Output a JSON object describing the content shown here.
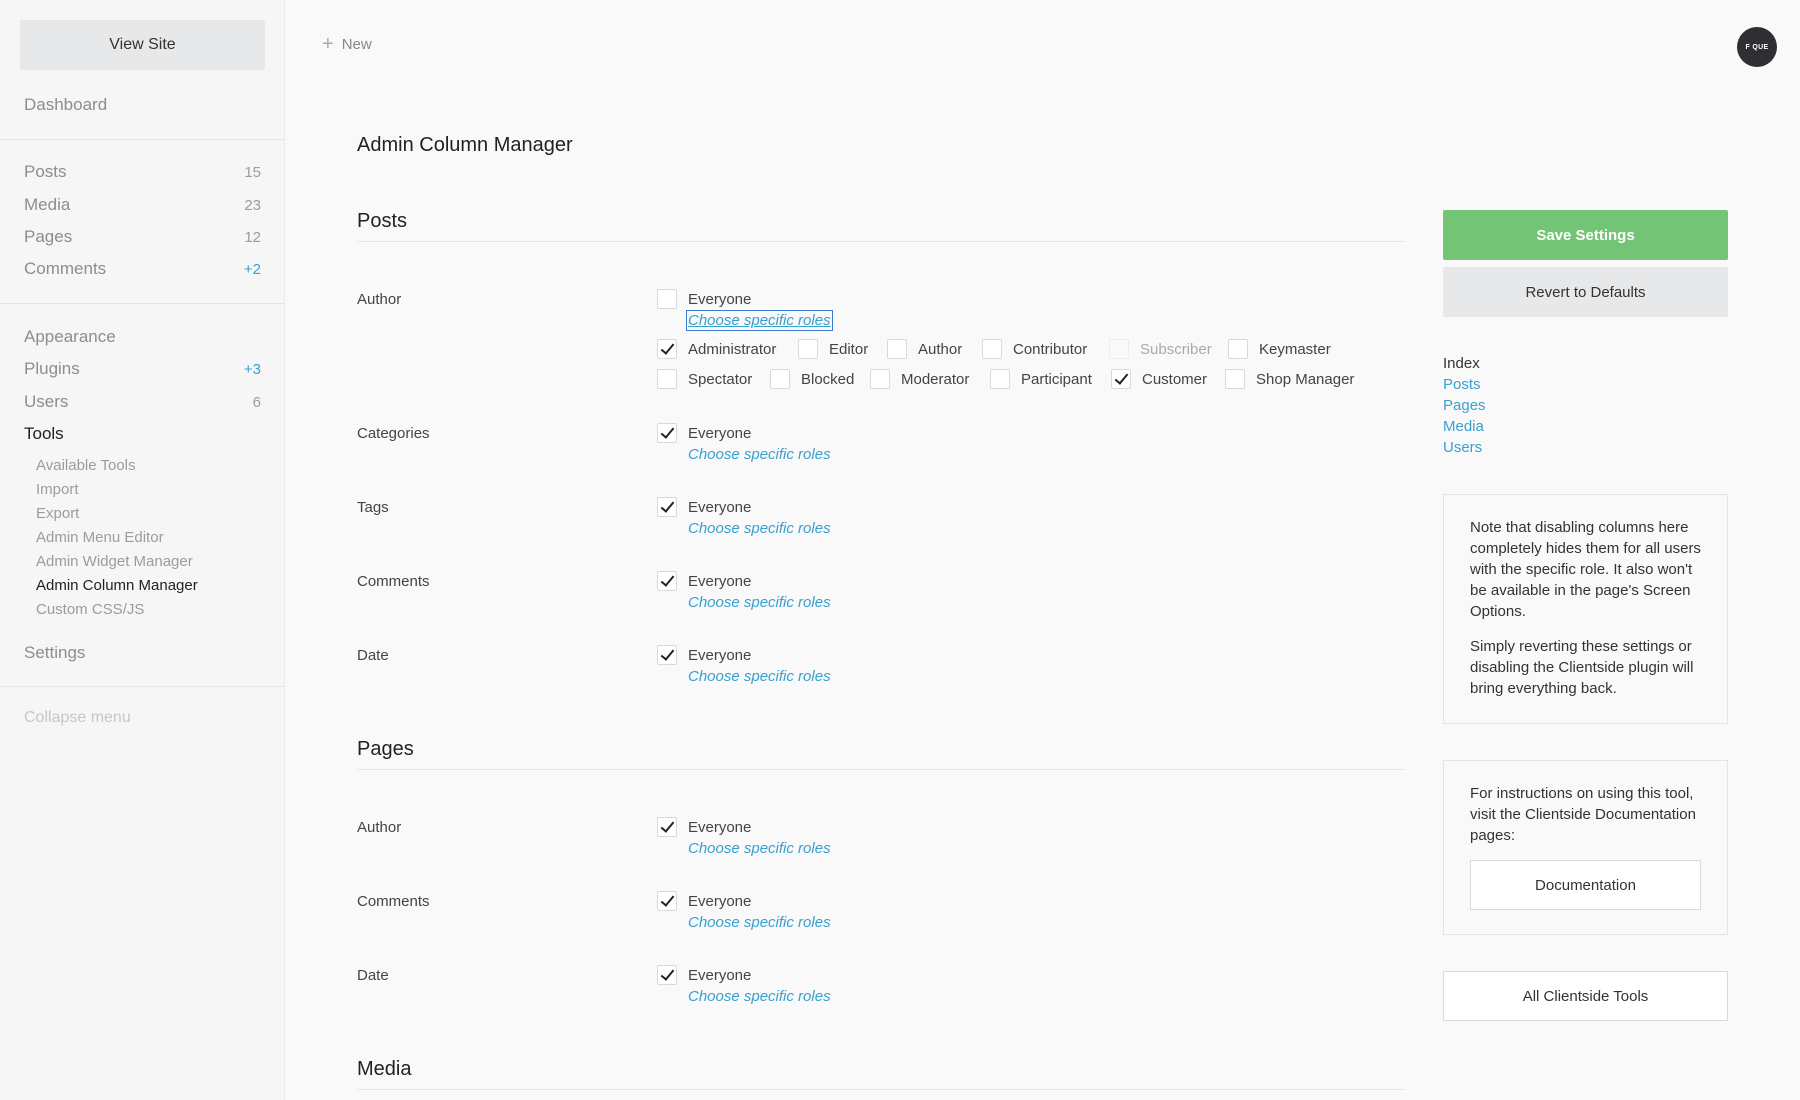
{
  "sidebar": {
    "view_site": "View Site",
    "dashboard": "Dashboard",
    "items": [
      {
        "label": "Posts",
        "count": "15"
      },
      {
        "label": "Media",
        "count": "23"
      },
      {
        "label": "Pages",
        "count": "12"
      },
      {
        "label": "Comments",
        "count": "+2"
      },
      {
        "label": "Appearance",
        "count": ""
      },
      {
        "label": "Plugins",
        "count": "+3"
      },
      {
        "label": "Users",
        "count": "6"
      },
      {
        "label": "Tools",
        "count": ""
      }
    ],
    "tools_sub": [
      "Available Tools",
      "Import",
      "Export",
      "Admin Menu Editor",
      "Admin Widget Manager",
      "Admin Column Manager",
      "Custom CSS/JS"
    ],
    "settings": "Settings",
    "collapse": "Collapse menu"
  },
  "topbar": {
    "new_label": "New",
    "avatar_text": "F QUE"
  },
  "main": {
    "title": "Admin Column Manager",
    "everyone": "Everyone",
    "choose_roles": "Choose specific roles",
    "sections": [
      {
        "title": "Posts",
        "rows": [
          "Author",
          "Categories",
          "Tags",
          "Comments",
          "Date"
        ]
      },
      {
        "title": "Pages",
        "rows": [
          "Author",
          "Comments",
          "Date"
        ]
      },
      {
        "title": "Media",
        "rows": []
      }
    ],
    "roles": [
      {
        "label": "Administrator",
        "checked": true
      },
      {
        "label": "Editor",
        "checked": false
      },
      {
        "label": "Author",
        "checked": false
      },
      {
        "label": "Contributor",
        "checked": false
      },
      {
        "label": "Subscriber",
        "checked": false,
        "disabled": true
      },
      {
        "label": "Keymaster",
        "checked": false
      },
      {
        "label": "Spectator",
        "checked": false
      },
      {
        "label": "Blocked",
        "checked": false
      },
      {
        "label": "Moderator",
        "checked": false
      },
      {
        "label": "Participant",
        "checked": false
      },
      {
        "label": "Customer",
        "checked": true
      },
      {
        "label": "Shop Manager",
        "checked": false
      }
    ]
  },
  "panel": {
    "save": "Save Settings",
    "revert": "Revert to Defaults",
    "index_title": "Index",
    "index_links": [
      "Posts",
      "Pages",
      "Media",
      "Users"
    ],
    "note_p1": "Note that disabling columns here completely hides them for all users with the specific role. It also won't be available in the page's Screen Options.",
    "note_p2": "Simply reverting these settings or disabling the Clientside plugin will bring everything back.",
    "docs_text": "For instructions on using this tool, visit the Clientside Documentation pages:",
    "docs_button": "Documentation",
    "all_tools": "All Clientside Tools"
  },
  "colors": {
    "accent_blue": "#3aa0cf",
    "save_green": "#74c475"
  }
}
